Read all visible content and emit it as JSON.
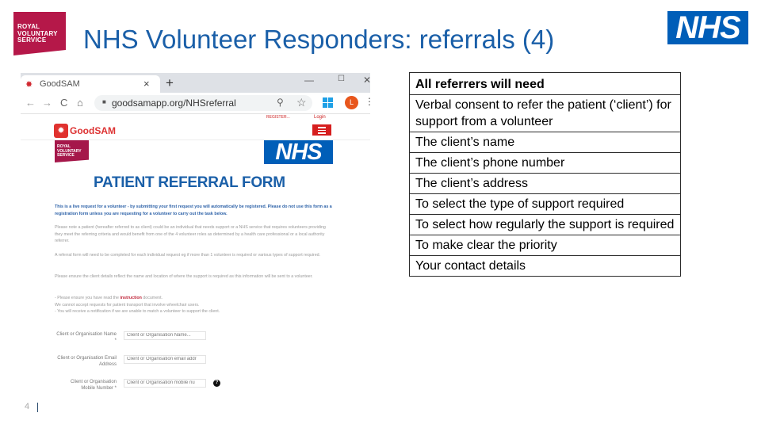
{
  "slide": {
    "title": "NHS Volunteer Responders: referrals (4)",
    "page_number": "4",
    "rvs_logo": {
      "lines": [
        "ROYAL",
        "VOLUNTARY",
        "SERVICE"
      ],
      "color": "#b51849"
    },
    "nhs_logo": {
      "text": "NHS",
      "color": "#005eb8"
    },
    "title_color": "#1a5fa8"
  },
  "browser": {
    "tab": {
      "icon": "goodsam-runner-icon",
      "title": "GoodSAM",
      "close": "×"
    },
    "new_tab": "+",
    "window_controls": {
      "minimize": "—",
      "maximize": "☐",
      "close": "✕"
    },
    "nav": {
      "back": "←",
      "forward": "→",
      "reload": "C",
      "home": "⌂"
    },
    "url": "goodsamapp.org/NHSreferral",
    "avatar_letter": "L",
    "menu": "⋮"
  },
  "site": {
    "register_link": "REGISTER...",
    "login_link": "Login",
    "brand": "GoodSAM",
    "rvs_lines": [
      "ROYAL",
      "VOLUNTARY",
      "SERVICE"
    ],
    "nhs_text": "NHS",
    "form_title": "PATIENT REFERRAL FORM",
    "intro_bold": "This is a live request for a volunteer - by submitting your first request you will automatically be registered. Please do not use this form as a registration form unless you are requesting for a volunteer to carry out the task below.",
    "para_1": "Please note a patient (hereafter referred to as client) could be an individual that needs support or a NHS service that requires volunteers providing they meet the referring criteria and would benefit from one of the 4 volunteer roles as determined by a health care professional or a local authority referrer.",
    "para_2": "A referral form will need to be completed for each individual request eg if more than 1 volunteer is required or various types of support required.",
    "para_3": "Please ensure the client details reflect the name and location of where the support is required as this information will be sent to a volunteer.",
    "bullet_1_pre": "- Please ensure you have read the ",
    "bullet_1_link": "instruction",
    "bullet_1_post": " document.",
    "bullet_2": "  We cannot accept requests for patient transport that involve wheelchair users.",
    "bullet_3": "- You will receive a notification if we are unable to match a volunteer to support the client.",
    "fields": [
      {
        "label": "Client or Organisation Name *",
        "placeholder": "Client or Organisation Name..."
      },
      {
        "label": "Client or Organisation Email Address",
        "placeholder": "Client or Organisation email addr"
      },
      {
        "label": "Client or Organisation Mobile Number *",
        "placeholder": "Client or Organisation mobile nu"
      }
    ],
    "help_icon": "?"
  },
  "requirements": {
    "header": "All referrers will need",
    "items": [
      "Verbal consent to refer the patient (‘client’) for support from a volunteer",
      "The client’s name",
      "The client’s phone number",
      "The client’s address",
      "To select the type of support required",
      "To select how regularly the support is required",
      "To make clear the priority",
      "Your contact details"
    ]
  }
}
